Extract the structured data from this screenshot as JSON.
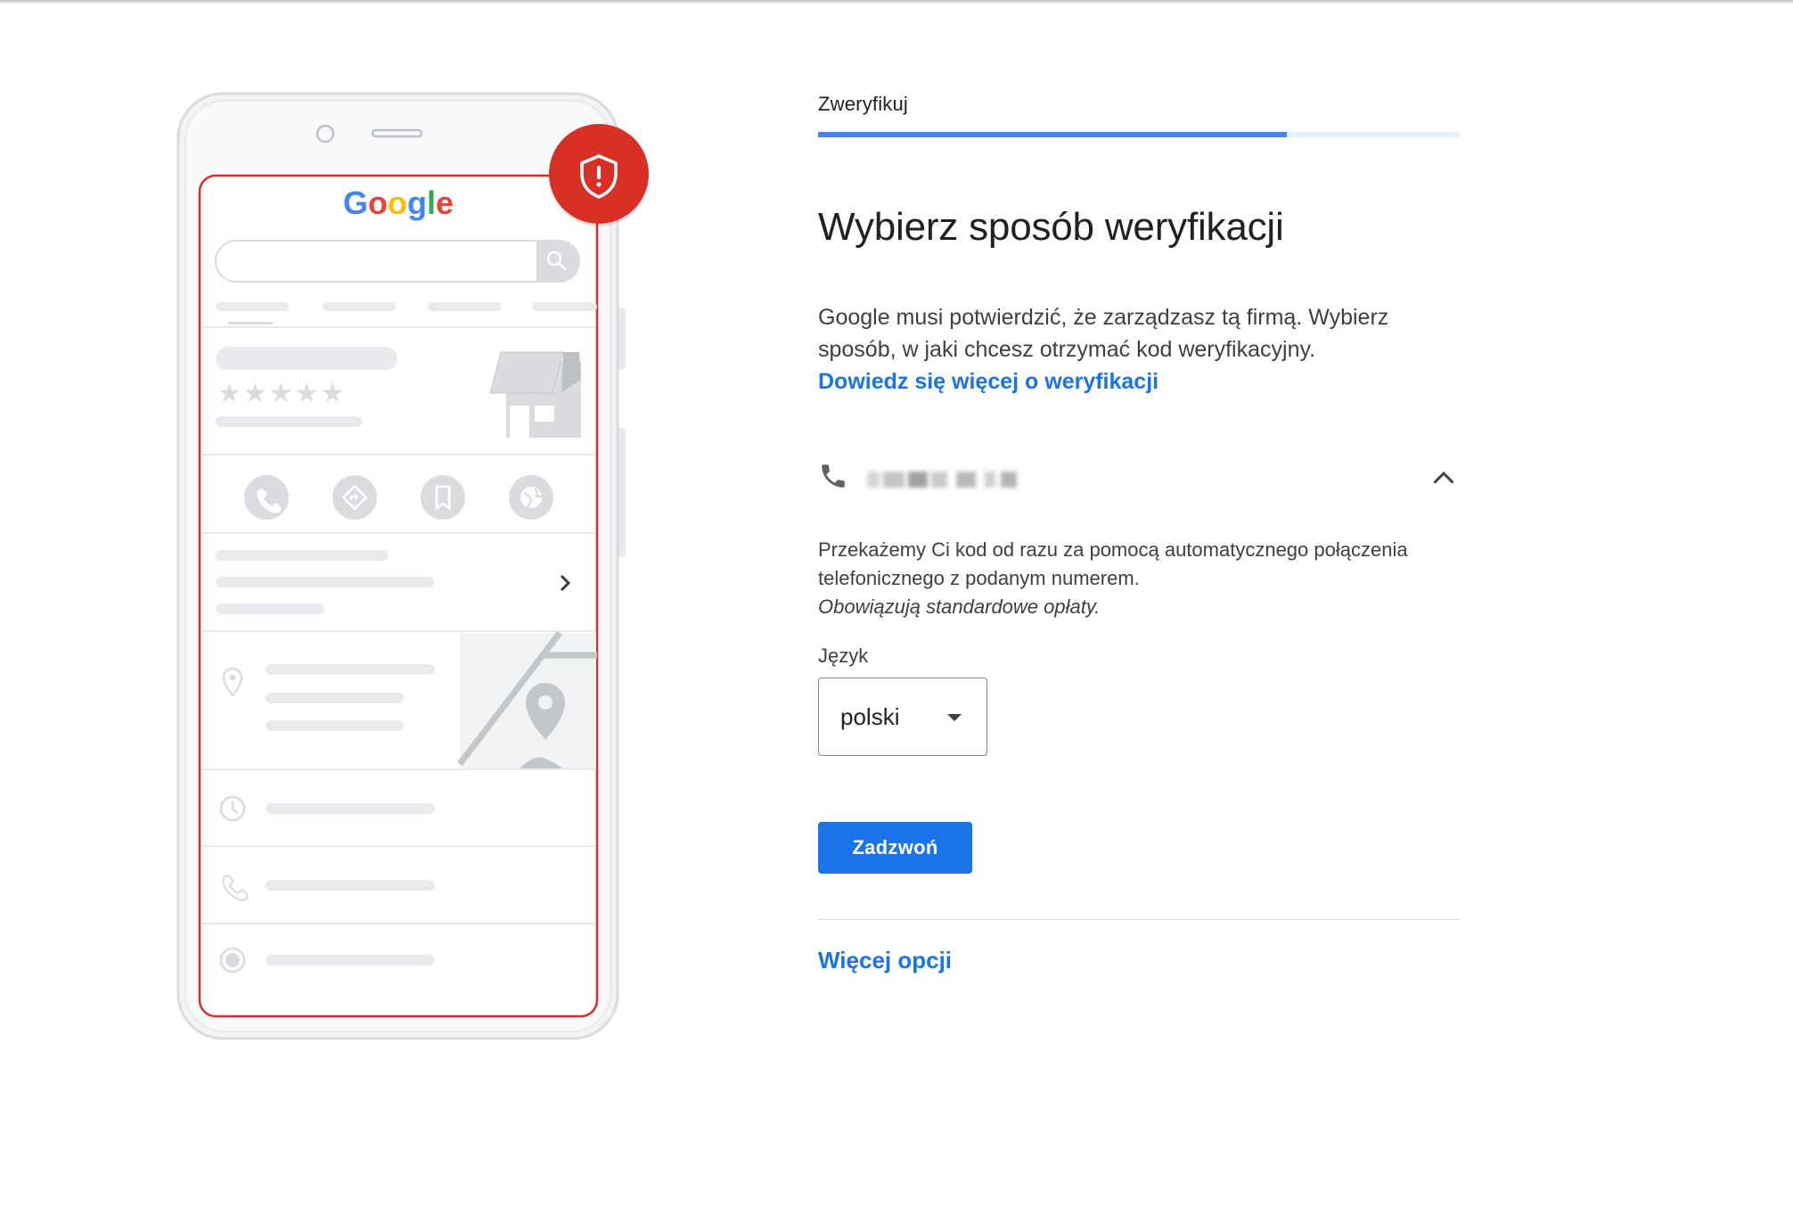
{
  "stepper": {
    "label": "Zweryfikuj",
    "progress_fraction": 0.73
  },
  "heading": "Wybierz sposób weryfikacji",
  "description": {
    "text": "Google musi potwierdzić, że zarządzasz tą firmą. Wybierz sposób, w jaki chcesz otrzymać kod weryfikacyjny.",
    "link": "Dowiedz się więcej o weryfikacji"
  },
  "method": {
    "icon": "phone-icon",
    "expand_icon": "chevron-up-icon",
    "info": "Przekażemy Ci kod od razu za pomocą automatycznego połączenia telefonicznego z podanym numerem.",
    "note": "Obowiązują standardowe opłaty."
  },
  "language": {
    "label": "Język",
    "value": "polski"
  },
  "call_button": "Zadzwoń",
  "more_options": "Więcej opcji",
  "illustration": {
    "logo_text": "Google",
    "badge_icon": "shield-alert-icon",
    "colors": {
      "alert_red": "#d93025",
      "logo_blue": "#4285f4",
      "logo_red": "#ea4335",
      "logo_yellow": "#fbbc05",
      "logo_green": "#34a853"
    }
  },
  "colors": {
    "accent": "#1a73e8",
    "progress": "#4285f4"
  }
}
